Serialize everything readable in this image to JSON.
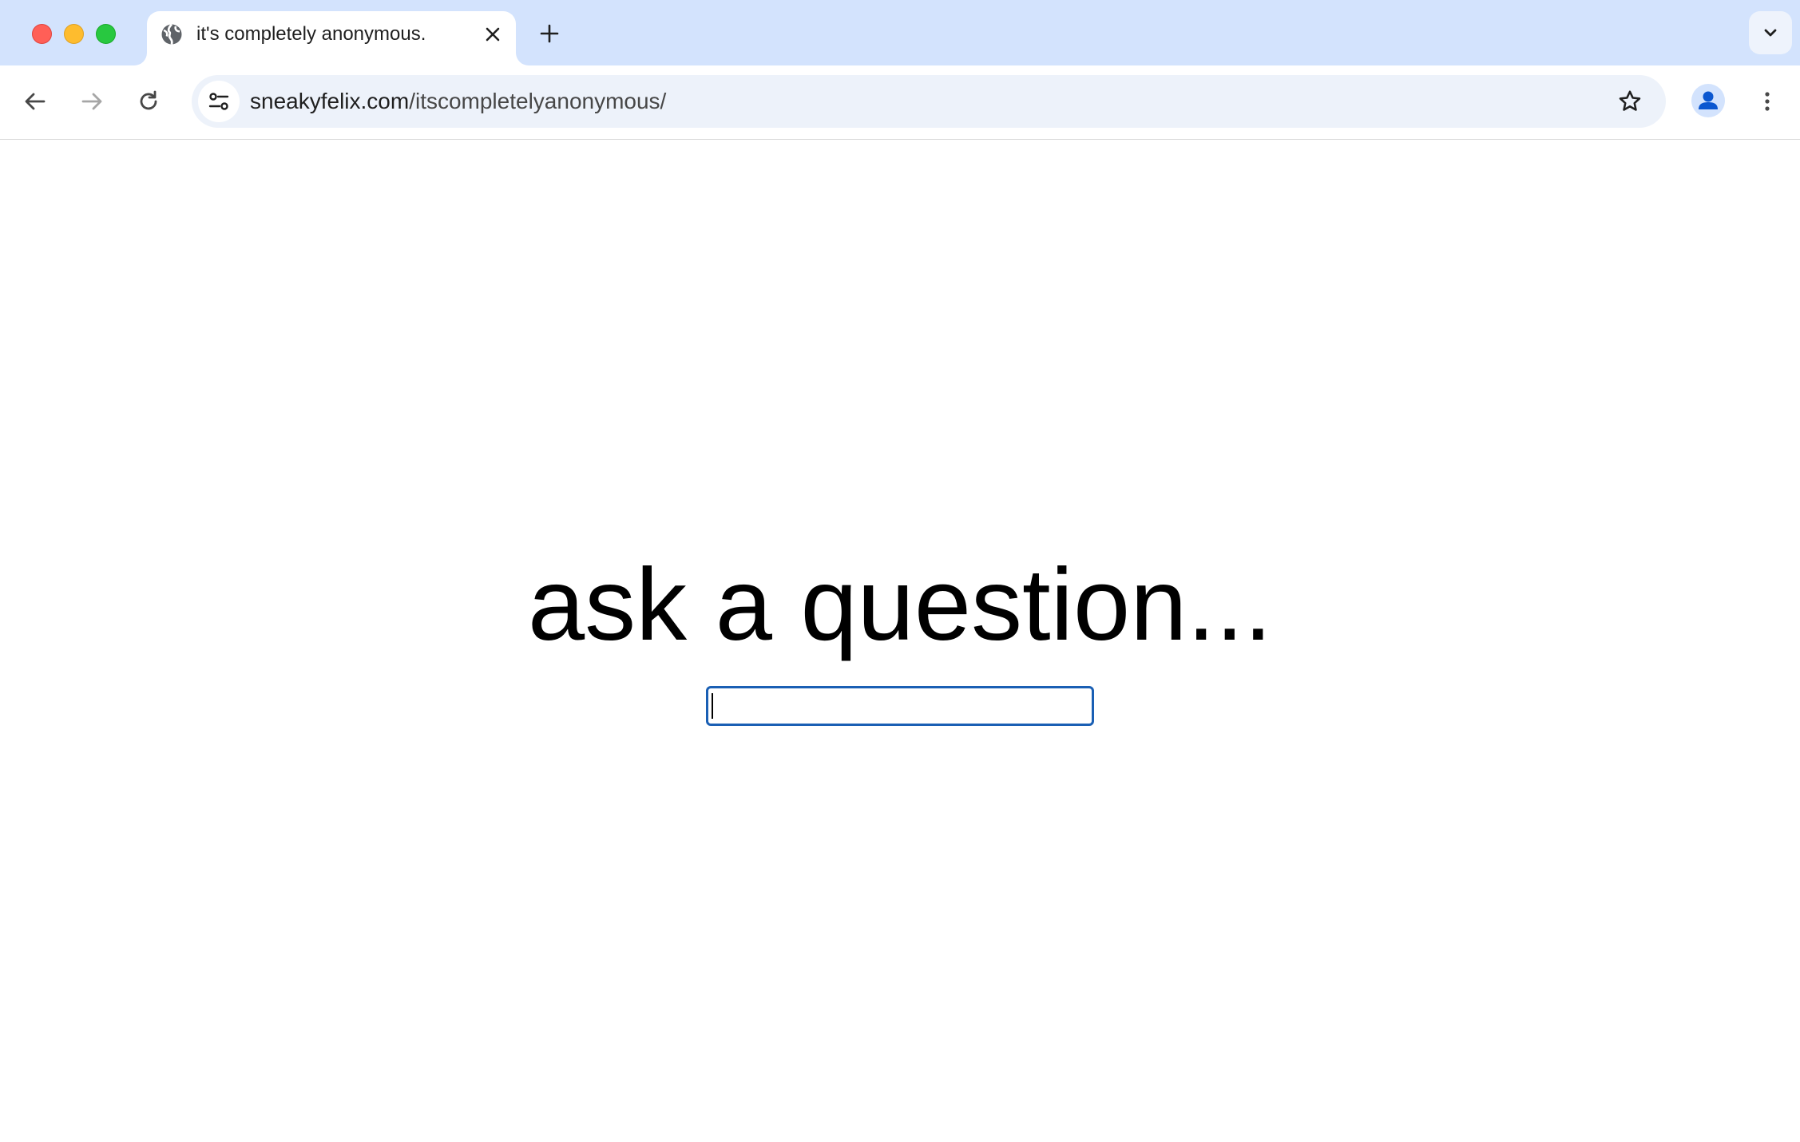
{
  "browser": {
    "tab": {
      "title": "it's completely anonymous.",
      "favicon": "globe-icon"
    },
    "new_tab_icon": "plus-icon",
    "tab_search_icon": "chevron-down-icon",
    "toolbar": {
      "back_icon": "arrow-left-icon",
      "forward_icon": "arrow-right-icon",
      "reload_icon": "reload-icon",
      "site_info_icon": "tune-icon",
      "bookmark_icon": "star-icon",
      "profile_icon": "person-icon",
      "menu_icon": "kebab-menu-icon"
    },
    "address": {
      "host": "sneakyfelix.com",
      "path": "/itscompletelyanonymous/"
    }
  },
  "page": {
    "heading": "ask a question...",
    "input": {
      "value": "",
      "placeholder": ""
    }
  },
  "colors": {
    "tabstrip_bg": "#d3e3fd",
    "omnibox_bg": "#edf2fa",
    "input_focus_border": "#1a5fb4",
    "traffic_close": "#ff5f57",
    "traffic_minimize": "#febc2e",
    "traffic_maximize": "#28c840"
  }
}
